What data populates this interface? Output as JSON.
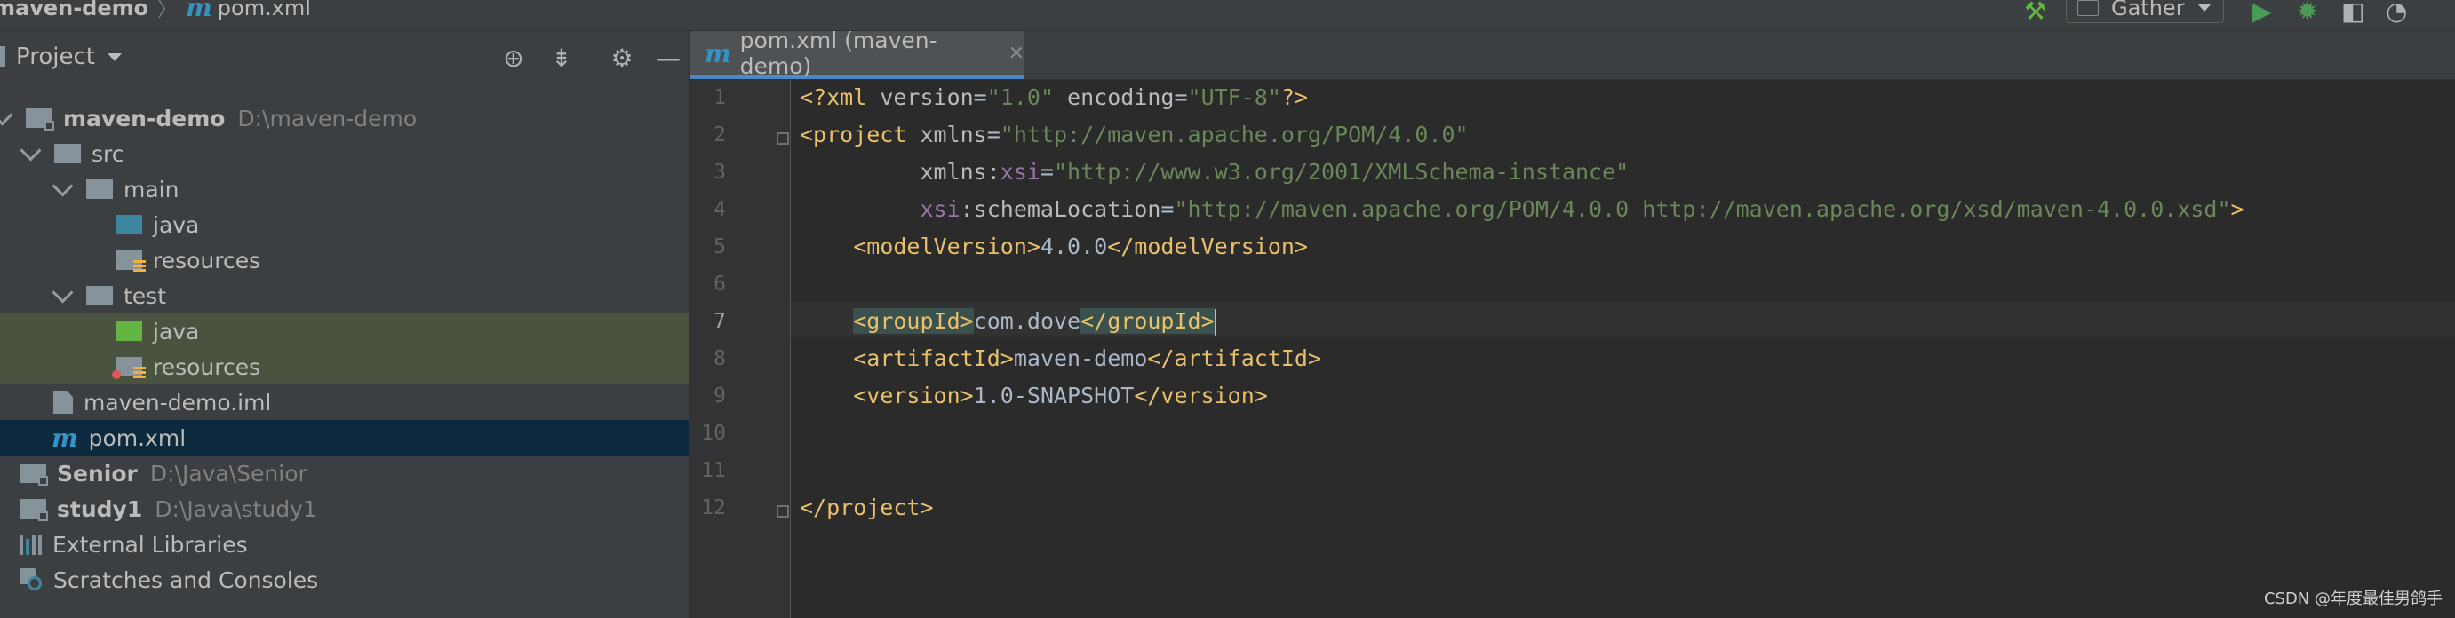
{
  "navbar": {
    "project": "maven-demo",
    "file_logo": "m",
    "file": "pom.xml",
    "run_config": "Gather"
  },
  "project_panel": {
    "title": "Project",
    "tree": [
      {
        "label": "maven-demo",
        "path": "D:\\maven-demo",
        "icon": "module-folder-icon",
        "bold": true
      },
      {
        "label": "src",
        "icon": "folder-icon"
      },
      {
        "label": "main",
        "icon": "folder-icon"
      },
      {
        "label": "java",
        "icon": "source-folder-icon"
      },
      {
        "label": "resources",
        "icon": "resources-folder-icon"
      },
      {
        "label": "test",
        "icon": "folder-icon"
      },
      {
        "label": "java",
        "icon": "test-source-folder-icon"
      },
      {
        "label": "resources",
        "icon": "test-resources-folder-icon"
      },
      {
        "label": "maven-demo.iml",
        "icon": "iml-file-icon"
      },
      {
        "label": "pom.xml",
        "icon": "maven-file-icon",
        "selected": true
      },
      {
        "label": "Senior",
        "path": "D:\\Java\\Senior",
        "icon": "module-folder-icon",
        "bold": true
      },
      {
        "label": "study1",
        "path": "D:\\Java\\study1",
        "icon": "module-folder-icon",
        "bold": true
      },
      {
        "label": "External Libraries",
        "icon": "libraries-icon"
      },
      {
        "label": "Scratches and Consoles",
        "icon": "scratches-icon"
      }
    ]
  },
  "editor": {
    "tab_label": "pom.xml (maven-demo)",
    "line_numbers": [
      "1",
      "2",
      "3",
      "4",
      "5",
      "6",
      "7",
      "8",
      "9",
      "10",
      "11",
      "12"
    ],
    "current_line": "7",
    "code": {
      "l1": {
        "p1": "<?xml ",
        "a1": "version",
        "e1": "=",
        "v1": "\"1.0\"",
        "a2": " encoding",
        "e2": "=",
        "v2": "\"UTF-8\"",
        "p2": "?>"
      },
      "l2": {
        "t": "<project ",
        "a": "xmlns",
        "e": "=",
        "v": "\"http://maven.apache.org/POM/4.0.0\""
      },
      "l3": {
        "indent": "         ",
        "a": "xmlns:",
        "ns": "xsi",
        "e": "=",
        "v": "\"http://www.w3.org/2001/XMLSchema-instance\""
      },
      "l4": {
        "indent": "         ",
        "ns": "xsi",
        "a": ":schemaLocation",
        "e": "=",
        "v": "\"http://maven.apache.org/POM/4.0.0 http://maven.apache.org/xsd/maven-4.0.0.xsd\"",
        "t": ">"
      },
      "l5": {
        "indent": "    ",
        "o": "<modelVersion>",
        "txt": "4.0.0",
        "c": "</modelVersion>"
      },
      "l7": {
        "indent": "    ",
        "o": "<groupId>",
        "txt": "com.dove",
        "c": "</groupId>"
      },
      "l8": {
        "indent": "    ",
        "o": "<artifactId>",
        "txt": "maven-demo",
        "c": "</artifactId>"
      },
      "l9": {
        "indent": "    ",
        "o": "<version>",
        "txt": "1.0-SNAPSHOT",
        "c": "</version>"
      },
      "l12": {
        "c": "</project>"
      }
    }
  },
  "watermark": "CSDN @年度最佳男鸽手",
  "colors": {
    "tag": "#e8bf6a",
    "string": "#6a8759",
    "namespace": "#9876aa",
    "selection": "#0d293e",
    "test_highlight": "#49533f"
  }
}
